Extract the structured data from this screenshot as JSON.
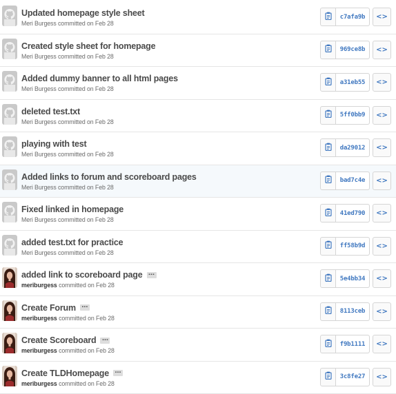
{
  "commits": [
    {
      "title": "Updated homepage style sheet",
      "author": "Meri Burgess",
      "author_type": "name",
      "committed": "committed on Feb 28",
      "sha": "c7afa9b",
      "avatar": "octocat-default-avatar",
      "has_expander": false
    },
    {
      "title": "Created style sheet for homepage",
      "author": "Meri Burgess",
      "author_type": "name",
      "committed": "committed on Feb 28",
      "sha": "969ce8b",
      "avatar": "octocat-default-avatar",
      "has_expander": false
    },
    {
      "title": "Added dummy banner to all html pages",
      "author": "Meri Burgess",
      "author_type": "name",
      "committed": "committed on Feb 28",
      "sha": "a31eb55",
      "avatar": "octocat-default-avatar",
      "has_expander": false
    },
    {
      "title": "deleted test.txt",
      "author": "Meri Burgess",
      "author_type": "name",
      "committed": "committed on Feb 28",
      "sha": "5ff0bb9",
      "avatar": "octocat-default-avatar",
      "has_expander": false
    },
    {
      "title": "playing with test",
      "author": "Meri Burgess",
      "author_type": "name",
      "committed": "committed on Feb 28",
      "sha": "da29012",
      "avatar": "octocat-default-avatar",
      "has_expander": false
    },
    {
      "title": "Added links to forum and scoreboard pages",
      "author": "Meri Burgess",
      "author_type": "name",
      "committed": "committed on Feb 28",
      "sha": "bad7c4e",
      "avatar": "octocat-default-avatar",
      "has_expander": false,
      "highlighted": true
    },
    {
      "title": "Fixed linked in homepage",
      "author": "Meri Burgess",
      "author_type": "name",
      "committed": "committed on Feb 28",
      "sha": "41ed790",
      "avatar": "octocat-default-avatar",
      "has_expander": false
    },
    {
      "title": "added test.txt for practice",
      "author": "Meri Burgess",
      "author_type": "name",
      "committed": "committed on Feb 28",
      "sha": "ff58b9d",
      "avatar": "octocat-default-avatar",
      "has_expander": false
    },
    {
      "title": "added link to scoreboard page",
      "author": "meriburgess",
      "author_type": "login",
      "committed": "committed on Feb 28",
      "sha": "5e4bb34",
      "avatar": "user-photo-avatar",
      "has_expander": true
    },
    {
      "title": "Create Forum",
      "author": "meriburgess",
      "author_type": "login",
      "committed": "committed on Feb 28",
      "sha": "8113ceb",
      "avatar": "user-photo-avatar",
      "has_expander": true
    },
    {
      "title": "Create Scoreboard",
      "author": "meriburgess",
      "author_type": "login",
      "committed": "committed on Feb 28",
      "sha": "f9b1111",
      "avatar": "user-photo-avatar",
      "has_expander": true
    },
    {
      "title": "Create TLDHomepage",
      "author": "meriburgess",
      "author_type": "login",
      "committed": "committed on Feb 28",
      "sha": "3c8fe27",
      "avatar": "user-photo-avatar",
      "has_expander": true
    }
  ],
  "icons": {
    "copy": "clipboard-icon",
    "browse": "code-brackets-icon",
    "expander": "ellipsis-icon"
  },
  "labels": {
    "expander": "…",
    "browse": "<>"
  },
  "colors": {
    "sha_link": "#4078c0",
    "title_text": "#4a4a4a",
    "meta_text": "#6a6a6a",
    "border": "#e5e5e5",
    "highlight_row": "#f5f9fc"
  }
}
